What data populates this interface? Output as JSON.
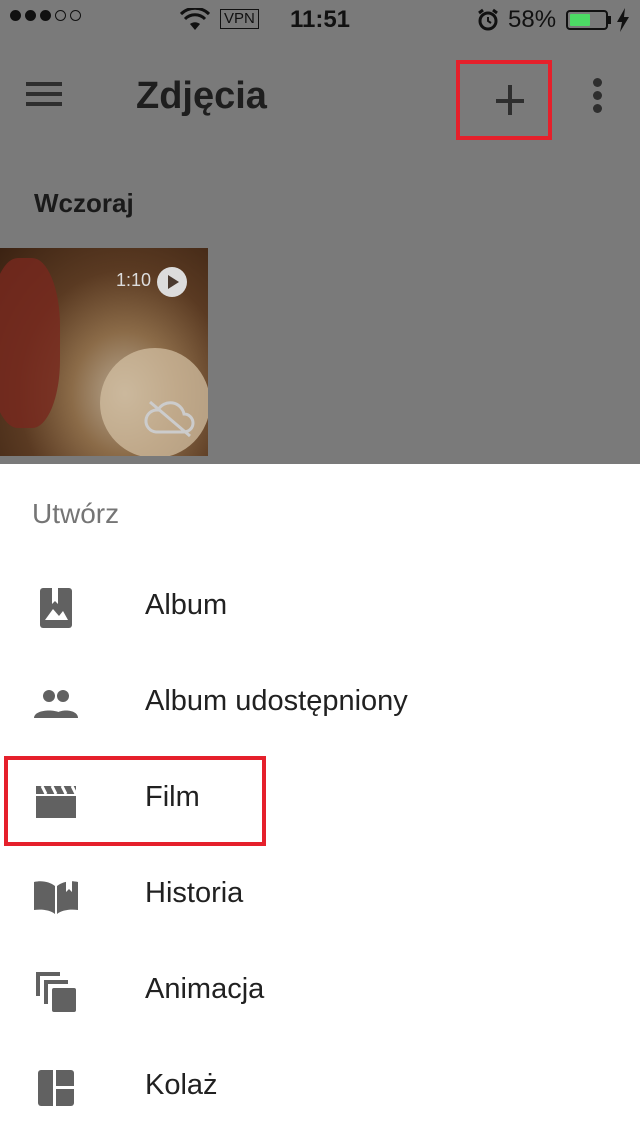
{
  "status_bar": {
    "carrier_signal": "●●●○○",
    "vpn": "VPN",
    "time": "11:51",
    "battery_percent": "58%",
    "battery_level": 0.58
  },
  "app_bar": {
    "title": "Zdjęcia"
  },
  "content": {
    "date_label": "Wczoraj",
    "thumbnail": {
      "duration": "1:10"
    }
  },
  "sheet": {
    "title": "Utwórz",
    "items": [
      {
        "label": "Album",
        "icon": "photo-album-icon"
      },
      {
        "label": "Album udostępniony",
        "icon": "people-icon"
      },
      {
        "label": "Film",
        "icon": "movie-clapper-icon"
      },
      {
        "label": "Historia",
        "icon": "book-open-icon"
      },
      {
        "label": "Animacja",
        "icon": "stacked-layers-icon"
      },
      {
        "label": "Kolaż",
        "icon": "collage-icon"
      }
    ]
  },
  "colors": {
    "highlight": "#e5202b",
    "overlay": "#7a7a7a",
    "icon": "#616161",
    "battery": "#4cd964"
  }
}
